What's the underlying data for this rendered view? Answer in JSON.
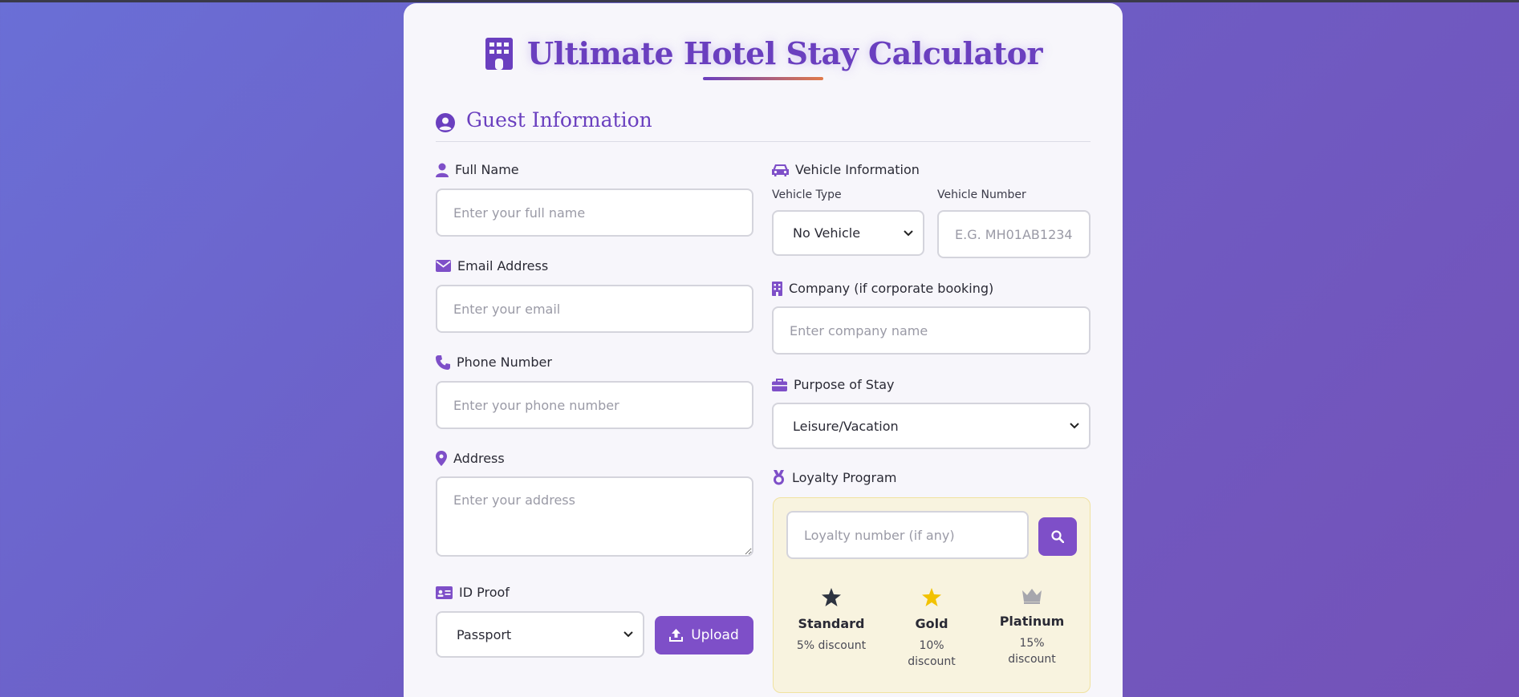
{
  "header": {
    "title": "Ultimate Hotel Stay Calculator"
  },
  "section": {
    "title": "Guest Information"
  },
  "fields": {
    "full_name": {
      "label": "Full Name",
      "placeholder": "Enter your full name"
    },
    "email": {
      "label": "Email Address",
      "placeholder": "Enter your email"
    },
    "phone": {
      "label": "Phone Number",
      "placeholder": "Enter your phone number"
    },
    "address": {
      "label": "Address",
      "placeholder": "Enter your address"
    },
    "id_proof": {
      "label": "ID Proof",
      "selected": "Passport",
      "upload_label": "Upload"
    },
    "vehicle": {
      "label": "Vehicle Information",
      "type_label": "Vehicle Type",
      "type_selected": "No Vehicle",
      "number_label": "Vehicle Number",
      "number_placeholder": "E.G. MH01AB1234"
    },
    "company": {
      "label": "Company (if corporate booking)",
      "placeholder": "Enter company name"
    },
    "purpose": {
      "label": "Purpose of Stay",
      "selected": "Leisure/Vacation"
    },
    "loyalty": {
      "label": "Loyalty Program",
      "placeholder": "Loyalty number (if any)",
      "tiers": [
        {
          "name": "Standard",
          "discount": "5% discount",
          "icon": "star-icon",
          "color": "#2d3340"
        },
        {
          "name": "Gold",
          "discount": "10% discount",
          "icon": "star-icon",
          "color": "#f2c200"
        },
        {
          "name": "Platinum",
          "discount": "15% discount",
          "icon": "crown-icon",
          "color": "#a6a6ad"
        }
      ]
    }
  },
  "colors": {
    "accent": "#7e4fc8",
    "title": "#6a3fbf"
  }
}
